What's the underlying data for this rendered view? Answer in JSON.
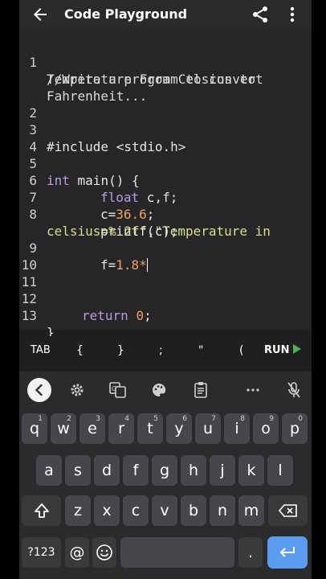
{
  "app": {
    "title": "Code Playground"
  },
  "editor": {
    "line_numbers": [
      "1",
      "2",
      "3",
      "4",
      "5",
      "6",
      "7",
      "8",
      "9",
      "10",
      "11",
      "12",
      "13"
    ],
    "lines": {
      "l1a": "//Write a program to convert",
      "l1b": "Temperature From Celsius to",
      "l1c": "Fahrenheit...",
      "l3": "#include <stdio.h>",
      "l5_kw": "int",
      "l5_rest": " main() {",
      "l6_kw": "float",
      "l6_rest": " c,f;",
      "l7_a": "c=",
      "l7_num": "36.6",
      "l7_b": ";",
      "l8_a": "printf(",
      "l8_str": "\"Temperature in",
      "l8b_str": "celsius=%.2f\"",
      "l8b_rest": ",c);",
      "l9_a": "f=",
      "l9_num": "1.8",
      "l9_b": "*",
      "l12_kw": "return",
      "l12_num": "0",
      "l12_b": ";",
      "l13": "}"
    }
  },
  "symbols": {
    "tab": "TAB",
    "s1": "{",
    "s2": "}",
    "s3": ";",
    "s4": "\"",
    "s5": "(",
    "run": "RUN"
  },
  "keyboard": {
    "row1": [
      "q",
      "w",
      "e",
      "r",
      "t",
      "y",
      "u",
      "i",
      "o",
      "p"
    ],
    "row1_hints": [
      "1",
      "2",
      "3",
      "4",
      "5",
      "6",
      "7",
      "8",
      "9",
      "0"
    ],
    "row2": [
      "a",
      "s",
      "d",
      "f",
      "g",
      "h",
      "j",
      "k",
      "l"
    ],
    "row3": [
      "z",
      "x",
      "c",
      "v",
      "b",
      "n",
      "m"
    ],
    "symbols_key": "?123",
    "at_key": "@",
    "period_key": "."
  },
  "colors": {
    "keyword": "#b79be0",
    "string": "#d9dd8a",
    "number": "#f0a060",
    "run": "#4caf50",
    "enter": "#5b9cf3"
  }
}
